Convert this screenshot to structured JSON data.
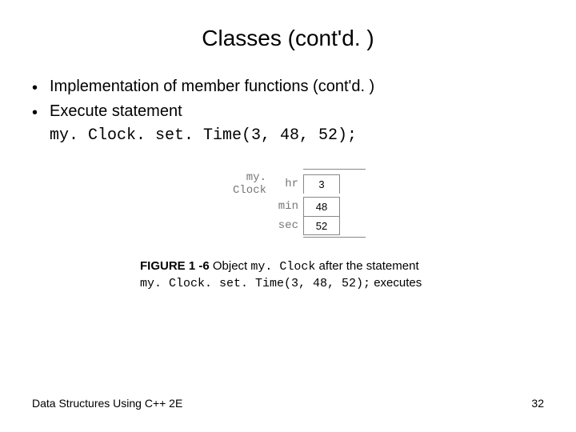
{
  "title": "Classes (cont'd. )",
  "bullets": [
    "Implementation of member functions (cont'd. )",
    "Execute statement"
  ],
  "code_line": "my. Clock. set. Time(3, 48, 52);",
  "figure": {
    "obj_name": "my. Clock",
    "rows": [
      {
        "label": "hr",
        "value": "3"
      },
      {
        "label": "min",
        "value": "48"
      },
      {
        "label": "sec",
        "value": "52"
      }
    ]
  },
  "caption": {
    "bold_lead": "FIGURE 1 -6",
    "plain1": " Object ",
    "mono1": "my. Clock",
    "plain2": " after the statement ",
    "mono2": "my. Clock. set. Time(3, 48, 52);",
    "plain3": " executes"
  },
  "footer": {
    "left": "Data Structures Using C++ 2E",
    "right": "32"
  }
}
